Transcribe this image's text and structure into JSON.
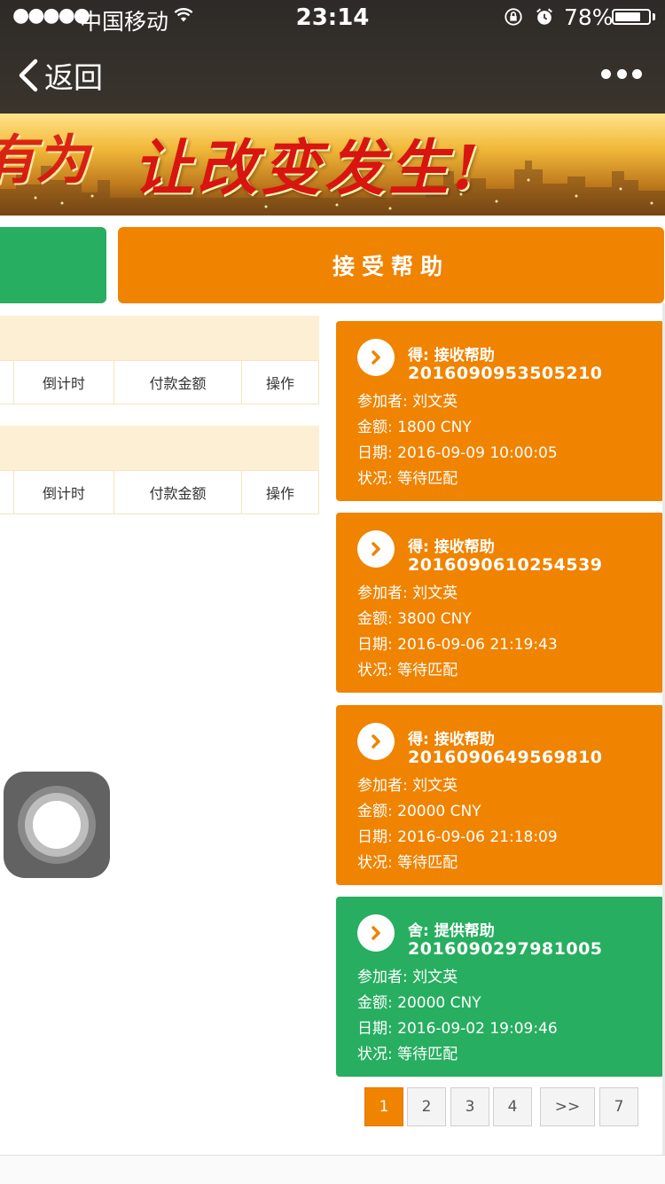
{
  "status_bar": {
    "signal": "●●●●●",
    "carrier": "中国移动",
    "time": "23:14",
    "battery_percent": "78%",
    "battery_level": 0.78
  },
  "nav": {
    "back_label": "返回"
  },
  "banner": {
    "slogan": "让改变发生!",
    "fragment": "有为"
  },
  "buttons": {
    "accept_help": "接受帮助"
  },
  "tables": [
    {
      "columns": [
        "倒计时",
        "付款金额",
        "操作"
      ]
    },
    {
      "columns": [
        "倒计时",
        "付款金额",
        "操作"
      ]
    }
  ],
  "cards": [
    {
      "color": "#f08300",
      "type": "得: 接收帮助",
      "id": "2016090953505210",
      "participant": "参加者: 刘文英",
      "amount": "金额: 1800 CNY",
      "date": "日期: 2016-09-09 10:00:05",
      "status": "状况: 等待匹配"
    },
    {
      "color": "#f08300",
      "type": "得: 接收帮助",
      "id": "2016090610254539",
      "participant": "参加者: 刘文英",
      "amount": "金额: 3800 CNY",
      "date": "日期: 2016-09-06 21:19:43",
      "status": "状况: 等待匹配"
    },
    {
      "color": "#f08300",
      "type": "得: 接收帮助",
      "id": "2016090649569810",
      "participant": "参加者: 刘文英",
      "amount": "金额: 20000 CNY",
      "date": "日期: 2016-09-06 21:18:09",
      "status": "状况: 等待匹配"
    },
    {
      "color": "#27ae60",
      "type": "舍: 提供帮助",
      "id": "2016090297981005",
      "participant": "参加者: 刘文英",
      "amount": "金额: 20000 CNY",
      "date": "日期: 2016-09-02 19:09:46",
      "status": "状况: 等待匹配"
    }
  ],
  "pagination": {
    "pages": [
      "1",
      "2",
      "3",
      "4",
      ">>",
      "7"
    ],
    "active": "1"
  },
  "colors": {
    "accent_orange": "#f08300",
    "accent_green": "#27ae60",
    "table_header_bg": "#fcefd4",
    "nav_bg": "#3b342d"
  }
}
